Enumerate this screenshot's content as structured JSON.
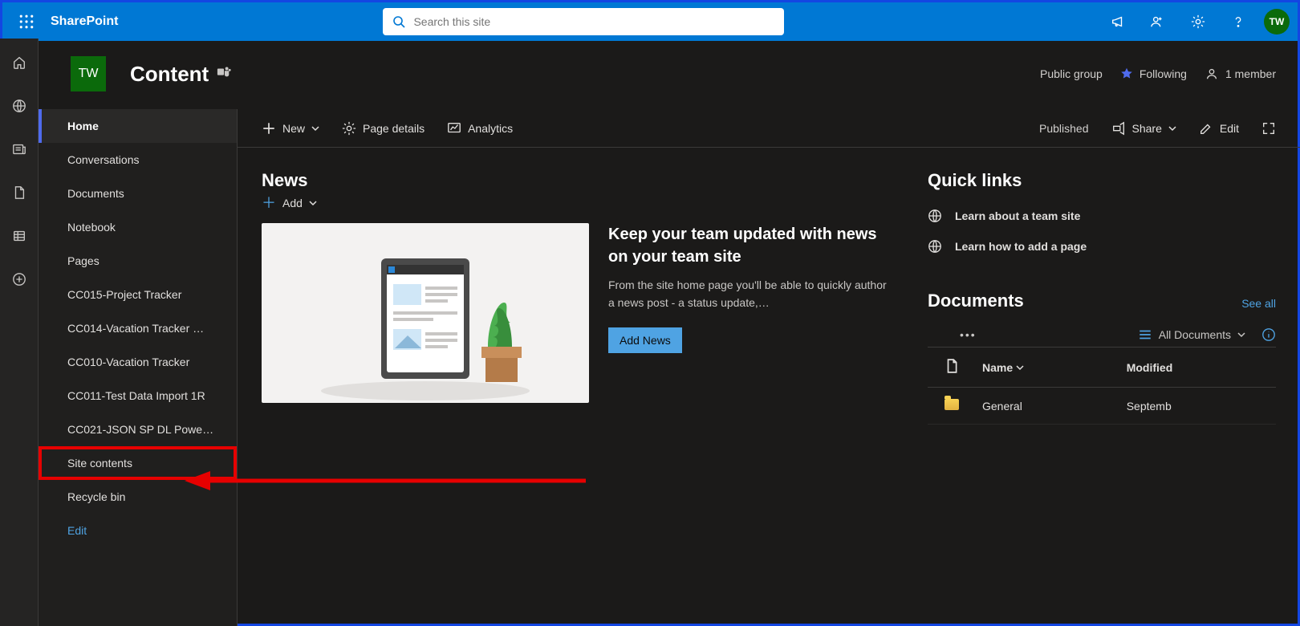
{
  "brand": "SharePoint",
  "search": {
    "placeholder": "Search this site"
  },
  "avatar_initials": "TW",
  "site": {
    "logo_text": "TW",
    "title": "Content",
    "group_type": "Public group",
    "following_label": "Following",
    "members_label": "1 member"
  },
  "cmdbar": {
    "new_label": "New",
    "page_details": "Page details",
    "analytics": "Analytics",
    "published": "Published",
    "share": "Share",
    "edit": "Edit"
  },
  "sitenav": [
    {
      "label": "Home",
      "active": true
    },
    {
      "label": "Conversations"
    },
    {
      "label": "Documents"
    },
    {
      "label": "Notebook"
    },
    {
      "label": "Pages"
    },
    {
      "label": "CC015-Project Tracker"
    },
    {
      "label": "CC014-Vacation Tracker …"
    },
    {
      "label": "CC010-Vacation Tracker"
    },
    {
      "label": "CC011-Test Data Import 1R"
    },
    {
      "label": "CC021-JSON SP DL Powe…"
    },
    {
      "label": "Site contents",
      "highlighted": true
    },
    {
      "label": "Recycle bin"
    },
    {
      "label": "Edit",
      "is_edit": true
    }
  ],
  "news": {
    "title": "News",
    "add_label": "Add",
    "headline": "Keep your team updated with news on your team site",
    "body": "From the site home page you'll be able to quickly author a news post - a status update,…",
    "button": "Add News"
  },
  "quick_links": {
    "title": "Quick links",
    "items": [
      {
        "label": "Learn about a team site"
      },
      {
        "label": "Learn how to add a page"
      }
    ]
  },
  "documents": {
    "title": "Documents",
    "see_all": "See all",
    "view_label": "All Documents",
    "columns": {
      "name": "Name",
      "modified": "Modified"
    },
    "rows": [
      {
        "name": "General",
        "modified": "Septemb"
      }
    ]
  }
}
